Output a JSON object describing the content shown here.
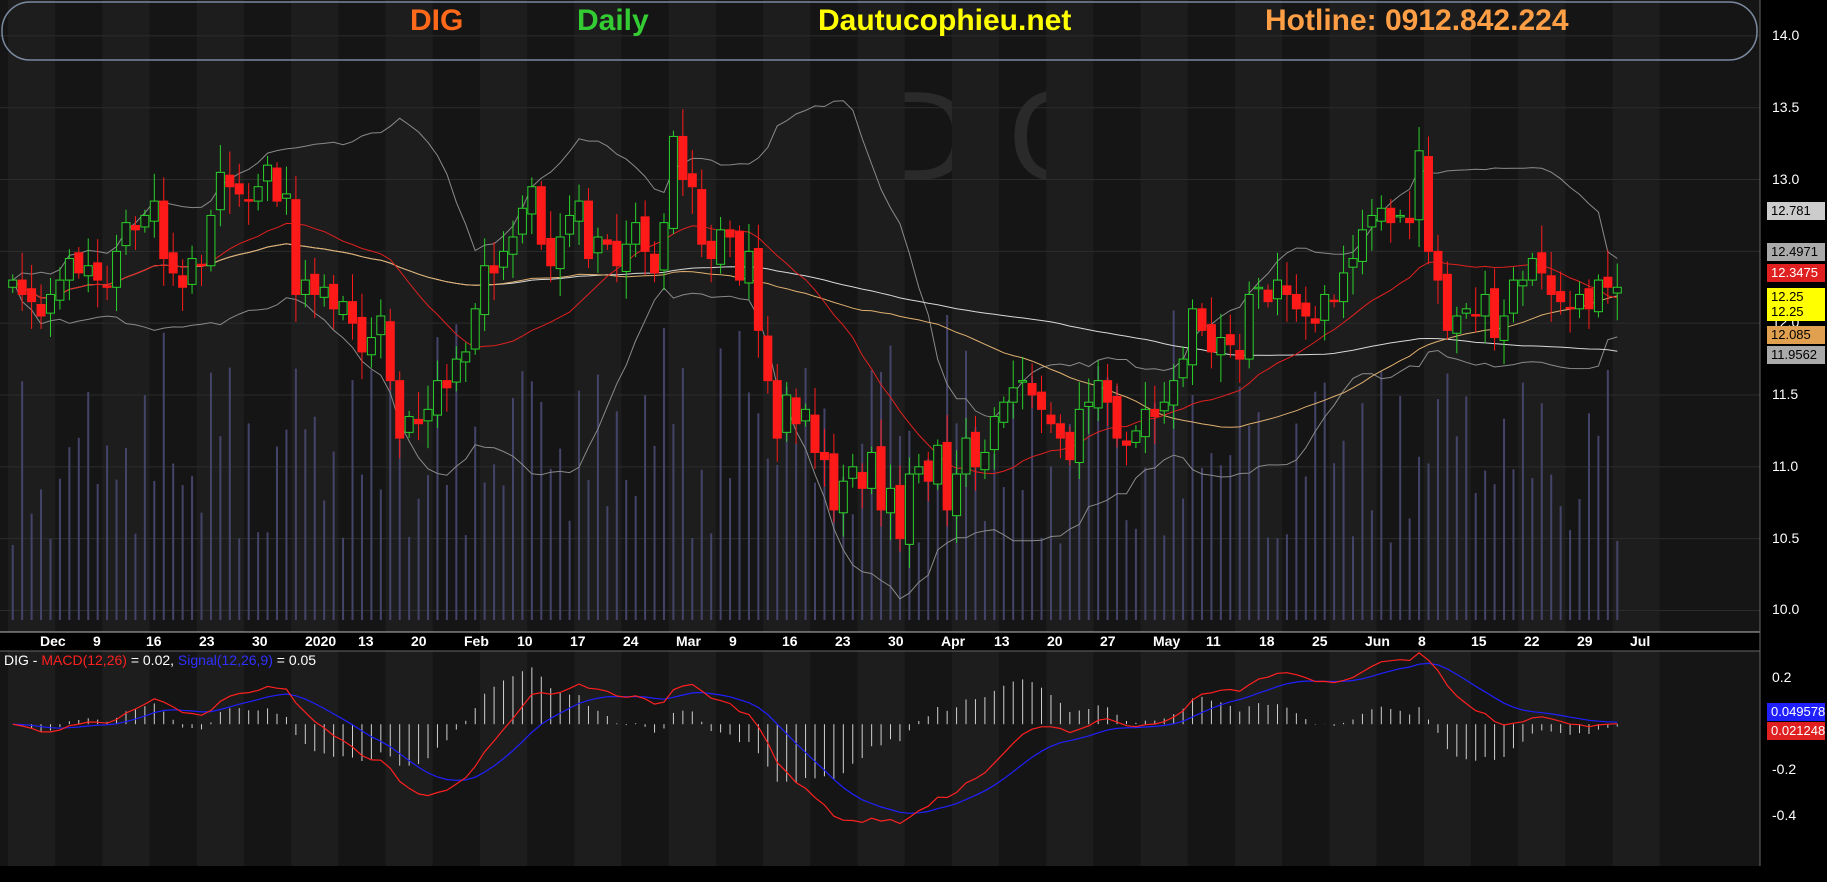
{
  "header": {
    "ticker": "DIG",
    "period": "Daily",
    "site": "Dautucophieu.net",
    "hotline": "Hotline: 0912.842.224"
  },
  "colors": {
    "background": "#000000",
    "panel": "#151515",
    "up": "#2bd12b",
    "down": "#ff1a1a",
    "volume": "#44446a",
    "ma_fast": "#e02020",
    "ma_mid": "#e0b070",
    "ma_slow": "#d8d8d8",
    "bollinger": "#8a8a8a",
    "macd_line": "#ff2020",
    "signal_line": "#2020ff",
    "histogram": "#cfcfcf"
  },
  "chart_data": {
    "type": "candlestick",
    "title": "DIG Daily",
    "watermark": "DIG",
    "ylim": [
      9.85,
      14.25
    ],
    "y_ticks": [
      "14.0",
      "13.5",
      "13.0",
      "12.5",
      "12.0",
      "11.5",
      "11.0",
      "10.5",
      "10.0"
    ],
    "x_ticks": [
      "Dec",
      "9",
      "16",
      "23",
      "30",
      "2020",
      "13",
      "20",
      "Feb",
      "10",
      "17",
      "24",
      "Mar",
      "9",
      "16",
      "23",
      "30",
      "Apr",
      "13",
      "20",
      "27",
      "May",
      "11",
      "18",
      "25",
      "Jun",
      "8",
      "15",
      "22",
      "29",
      "Jul"
    ],
    "close": [
      12.3,
      12.2,
      12.15,
      12.05,
      12.2,
      12.3,
      12.45,
      12.35,
      12.4,
      12.3,
      12.25,
      12.5,
      12.7,
      12.65,
      12.75,
      12.85,
      12.45,
      12.35,
      12.25,
      12.45,
      12.4,
      12.75,
      13.05,
      12.95,
      12.9,
      12.85,
      12.95,
      13.1,
      12.85,
      12.9,
      12.2,
      12.3,
      12.2,
      12.25,
      12.1,
      12.15,
      12.0,
      11.8,
      11.9,
      12.05,
      11.6,
      11.2,
      11.35,
      11.3,
      11.4,
      11.6,
      11.55,
      11.75,
      11.8,
      12.1,
      12.4,
      12.35,
      12.5,
      12.6,
      12.8,
      12.95,
      12.55,
      12.4,
      12.6,
      12.75,
      12.85,
      12.45,
      12.6,
      12.55,
      12.4,
      12.55,
      12.7,
      12.5,
      12.35,
      12.7,
      13.3,
      13.0,
      12.95,
      12.55,
      12.45,
      12.65,
      12.6,
      12.3,
      12.5,
      11.95,
      11.6,
      11.2,
      11.5,
      11.3,
      11.4,
      11.1,
      11.05,
      10.7,
      10.9,
      11.0,
      10.85,
      11.1,
      10.7,
      10.85,
      10.5,
      10.95,
      11.0,
      10.9,
      11.15,
      10.7,
      10.95,
      11.2,
      11.0,
      11.1,
      11.35,
      11.45,
      11.55,
      11.6,
      11.5,
      11.4,
      11.3,
      11.2,
      11.05,
      11.4,
      11.45,
      11.6,
      11.45,
      11.2,
      11.15,
      11.25,
      11.4,
      11.35,
      11.45,
      11.6,
      11.75,
      12.1,
      11.95,
      11.8,
      11.9,
      11.85,
      11.75,
      12.2,
      12.25,
      12.15,
      12.3,
      12.2,
      12.1,
      12.05,
      12.0,
      12.2,
      12.15,
      12.35,
      12.45,
      12.65,
      12.75,
      12.8,
      12.7,
      12.75,
      12.7,
      13.2,
      12.5,
      12.3,
      11.95,
      12.05,
      12.1,
      12.05,
      12.2,
      11.9,
      12.05,
      12.3,
      12.3,
      12.45,
      12.35,
      12.2,
      12.15,
      12.1,
      12.2,
      12.1,
      12.3,
      12.25,
      12.25
    ],
    "overlays": {
      "ma_fast_label": "12.3475",
      "ma_mid_label": "12.085",
      "ma_slow_label": "12.781",
      "bb_upper_label": "12.4971",
      "bb_lower_label": "11.9562",
      "last_close_label": "12.25",
      "last_price_label": "12.25"
    },
    "macd": {
      "ylim": [
        -0.62,
        0.32
      ],
      "y_ticks": [
        "0.2",
        "-0.2",
        "-0.4"
      ],
      "macd_label": "0.021248",
      "signal_label": "0.049578"
    }
  },
  "macd": {
    "legend": {
      "ticker": "DIG",
      "macd_name": "MACD(12,26)",
      "macd_value": " = 0.02,",
      "signal_name": "Signal(12,26,9)",
      "signal_value": " = 0.05"
    }
  }
}
